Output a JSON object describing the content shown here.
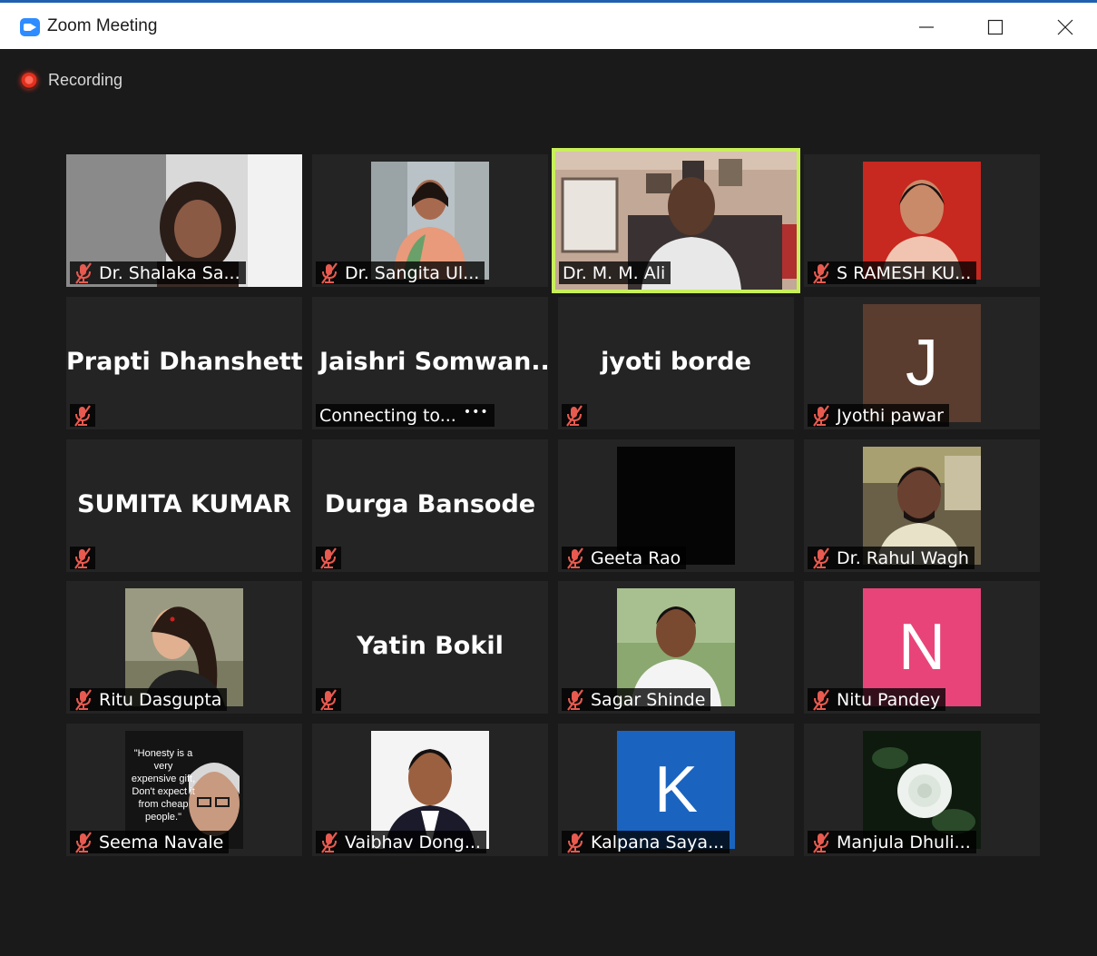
{
  "window": {
    "title": "Zoom Meeting"
  },
  "recording": {
    "label": "Recording"
  },
  "colors": {
    "active_speaker_border": "#c8ef5a",
    "muted_icon": "#e85a4f",
    "recording_dot": "#e0301e"
  },
  "participants": [
    {
      "name": "Dr. Shalaka Sa...",
      "muted": true,
      "video": "photo"
    },
    {
      "name": "Dr. Sangita Ul...",
      "muted": true,
      "video": "photo"
    },
    {
      "name": "Dr. M. M. Ali",
      "muted": false,
      "video": "live",
      "active_speaker": true
    },
    {
      "name": "S RAMESH KU...",
      "muted": true,
      "video": "photo"
    },
    {
      "name": "Prapti Dhanshetti",
      "muted": true,
      "video": "off"
    },
    {
      "name": "Jaishri  Somwan...",
      "status": "Connecting to...",
      "video": "off"
    },
    {
      "name": "jyoti borde",
      "muted": true,
      "video": "off"
    },
    {
      "name": "Jyothi pawar",
      "muted": true,
      "video": "avatar",
      "avatar_letter": "J",
      "avatar_color": "#5a3d2f"
    },
    {
      "name": "SUMITA KUMAR",
      "muted": true,
      "video": "off"
    },
    {
      "name": "Durga Bansode",
      "muted": true,
      "video": "off"
    },
    {
      "name": "Geeta Rao",
      "muted": true,
      "video": "black"
    },
    {
      "name": "Dr. Rahul Wagh",
      "muted": true,
      "video": "photo"
    },
    {
      "name": "Ritu Dasgupta",
      "muted": true,
      "video": "photo"
    },
    {
      "name": "Yatin Bokil",
      "muted": true,
      "video": "off"
    },
    {
      "name": "Sagar Shinde",
      "muted": true,
      "video": "photo"
    },
    {
      "name": "Nitu Pandey",
      "muted": true,
      "video": "avatar",
      "avatar_letter": "N",
      "avatar_color": "#e8447a"
    },
    {
      "name": "Seema Navale",
      "muted": true,
      "video": "photo",
      "photo_quote": "\"Honesty is a very expensive gift, Don't expect it from cheap people.\""
    },
    {
      "name": "Vaibhav Dong...",
      "muted": true,
      "video": "photo"
    },
    {
      "name": "Kalpana Saya...",
      "muted": true,
      "video": "avatar",
      "avatar_letter": "K",
      "avatar_color": "#1a64c0"
    },
    {
      "name": "Manjula Dhuli...",
      "muted": true,
      "video": "photo"
    }
  ]
}
